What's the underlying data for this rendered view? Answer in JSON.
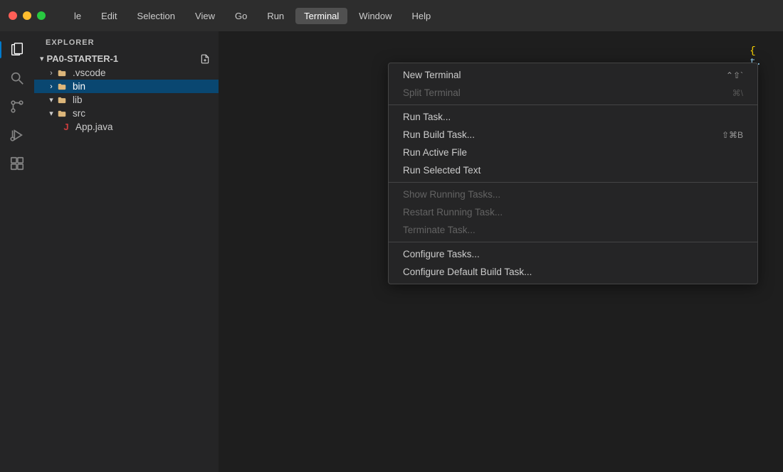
{
  "menubar": {
    "items": [
      {
        "id": "file",
        "label": "le"
      },
      {
        "id": "edit",
        "label": "Edit"
      },
      {
        "id": "selection",
        "label": "Selection"
      },
      {
        "id": "view",
        "label": "View"
      },
      {
        "id": "go",
        "label": "Go"
      },
      {
        "id": "run",
        "label": "Run"
      },
      {
        "id": "terminal",
        "label": "Terminal",
        "active": true
      },
      {
        "id": "window",
        "label": "Window"
      },
      {
        "id": "help",
        "label": "Help"
      }
    ]
  },
  "sidebar": {
    "header": "EXPLORER",
    "root": {
      "label": "PA0-STARTER-1",
      "icon": "chevron-down"
    },
    "items": [
      {
        "id": "vscode",
        "label": ".vscode",
        "depth": 1,
        "type": "folder",
        "collapsed": true
      },
      {
        "id": "bin",
        "label": "bin",
        "depth": 1,
        "type": "folder",
        "collapsed": true,
        "selected": true
      },
      {
        "id": "lib",
        "label": "lib",
        "depth": 1,
        "type": "folder",
        "collapsed": false
      },
      {
        "id": "src",
        "label": "src",
        "depth": 1,
        "type": "folder",
        "collapsed": false
      },
      {
        "id": "appjava",
        "label": "App.java",
        "depth": 2,
        "type": "java-file"
      }
    ]
  },
  "dropdown": {
    "items": [
      {
        "id": "new-terminal",
        "label": "New Terminal",
        "shortcut": "⌃⇧`",
        "disabled": false
      },
      {
        "id": "split-terminal",
        "label": "Split Terminal",
        "shortcut": "⌘\\",
        "disabled": true
      },
      {
        "separator": true
      },
      {
        "id": "run-task",
        "label": "Run Task...",
        "shortcut": "",
        "disabled": false
      },
      {
        "id": "run-build-task",
        "label": "Run Build Task...",
        "shortcut": "⇧⌘B",
        "disabled": false
      },
      {
        "id": "run-active-file",
        "label": "Run Active File",
        "shortcut": "",
        "disabled": false
      },
      {
        "id": "run-selected-text",
        "label": "Run Selected Text",
        "shortcut": "",
        "disabled": false
      },
      {
        "separator": true
      },
      {
        "id": "show-running-tasks",
        "label": "Show Running Tasks...",
        "shortcut": "",
        "disabled": true
      },
      {
        "id": "restart-running-task",
        "label": "Restart Running Task...",
        "shortcut": "",
        "disabled": true
      },
      {
        "id": "terminate-task",
        "label": "Terminate Task...",
        "shortcut": "",
        "disabled": true
      },
      {
        "separator": true
      },
      {
        "id": "configure-tasks",
        "label": "Configure Tasks...",
        "shortcut": "",
        "disabled": false
      },
      {
        "id": "configure-default-build-task",
        "label": "Configure Default Build Task...",
        "shortcut": "",
        "disabled": false
      }
    ]
  },
  "activity": {
    "icons": [
      {
        "id": "explorer",
        "symbol": "📄",
        "active": true
      },
      {
        "id": "search",
        "symbol": "🔍",
        "active": false
      },
      {
        "id": "source-control",
        "symbol": "⑂",
        "active": false
      },
      {
        "id": "run-debug",
        "symbol": "▷",
        "active": false
      },
      {
        "id": "extensions",
        "symbol": "⊞",
        "active": false
      }
    ]
  }
}
